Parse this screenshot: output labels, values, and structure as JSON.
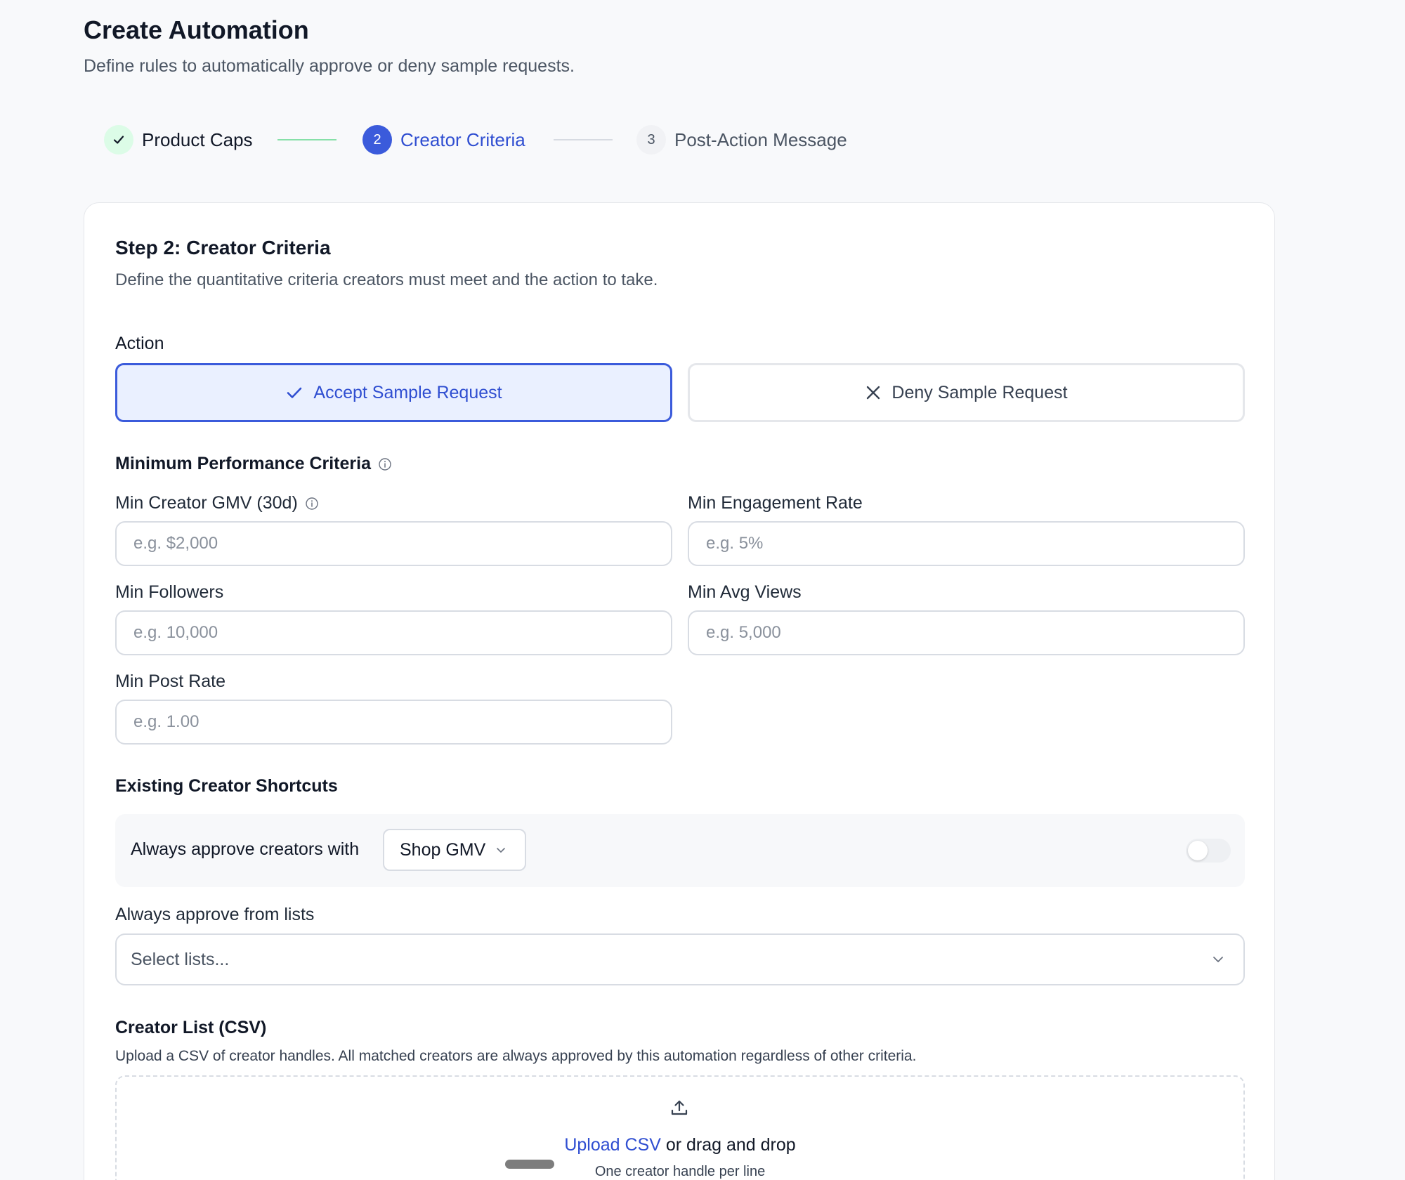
{
  "header": {
    "title": "Create Automation",
    "subtitle": "Define rules to automatically approve or deny sample requests."
  },
  "stepper": {
    "steps": [
      {
        "label": "Product Caps",
        "state": "completed",
        "icon": "check-icon"
      },
      {
        "label": "Creator Criteria",
        "state": "active",
        "number": "2"
      },
      {
        "label": "Post-Action Message",
        "state": "upcoming",
        "number": "3"
      }
    ]
  },
  "card": {
    "title": "Step 2: Creator Criteria",
    "description": "Define the quantitative criteria creators must meet and the action to take."
  },
  "action": {
    "label": "Action",
    "accept_label": "Accept Sample Request",
    "deny_label": "Deny Sample Request",
    "selected": "accept"
  },
  "criteria": {
    "section_label": "Minimum Performance Criteria",
    "fields": {
      "gmv": {
        "label": "Min Creator GMV (30d)",
        "placeholder": "e.g. $2,000",
        "value": ""
      },
      "engagement": {
        "label": "Min Engagement Rate",
        "placeholder": "e.g. 5%",
        "value": ""
      },
      "followers": {
        "label": "Min Followers",
        "placeholder": "e.g. 10,000",
        "value": ""
      },
      "avg_views": {
        "label": "Min Avg Views",
        "placeholder": "e.g. 5,000",
        "value": ""
      },
      "post_rate": {
        "label": "Min Post Rate",
        "placeholder": "e.g. 1.00",
        "value": ""
      }
    }
  },
  "shortcuts": {
    "section_label": "Existing Creator Shortcuts",
    "always_approve_text": "Always approve creators with",
    "metric_selected": "Shop GMV",
    "toggle_on": false,
    "lists_label": "Always approve from lists",
    "lists_placeholder": "Select lists..."
  },
  "csv": {
    "section_label": "Creator List (CSV)",
    "description": "Upload a CSV of creator handles. All matched creators are always approved by this automation regardless of other criteria.",
    "upload_link": "Upload CSV",
    "upload_suffix": " or drag and drop",
    "hint": "One creator handle per line"
  },
  "colors": {
    "accent": "#3b5bdb",
    "accent_text": "#2f4ed1",
    "accent_bg": "#eaf0ff",
    "success": "#16a34a",
    "success_bg": "#dcfce7"
  }
}
